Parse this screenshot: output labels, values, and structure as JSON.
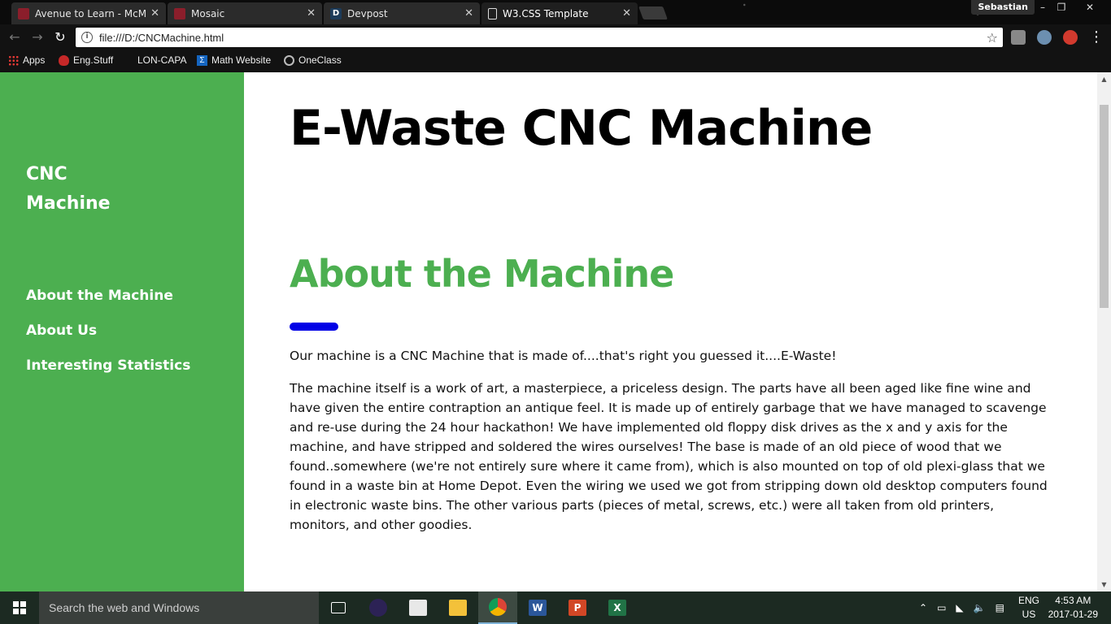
{
  "browser": {
    "tabs": [
      {
        "title": "Avenue to Learn - McMa",
        "active": false
      },
      {
        "title": "Mosaic",
        "active": false
      },
      {
        "title": "Devpost",
        "active": false
      },
      {
        "title": "W3.CSS Template",
        "active": true
      }
    ],
    "tab_close_glyph": "✕",
    "profile_name": "Sebastian",
    "address": "file:///D:/CNCMachine.html",
    "bookmarks": [
      "Apps",
      "Eng.Stuff",
      "LON-CAPA",
      "Math Website",
      "OneClass"
    ],
    "favicon_devpost": "D"
  },
  "page": {
    "brand": [
      "CNC",
      "Machine"
    ],
    "nav": [
      "About the Machine",
      "About Us",
      "Interesting Statistics"
    ],
    "title": "E-Waste CNC Machine",
    "section_title": "About the Machine",
    "paragraph1": "Our machine is a CNC Machine that is made of....that's right you guessed it....E-Waste!",
    "paragraph2": "The machine itself is a work of art, a masterpiece, a priceless design. The parts have all been aged like fine wine and have given the entire contraption an antique feel. It is made up of entirely garbage that we have managed to scavenge and re-use during the 24 hour hackathon! We have implemented old floppy disk drives as the x and y axis for the machine, and have stripped and soldered the wires ourselves! The base is made of an old piece of wood that we found..somewhere (we're not entirely sure where it came from), which is also mounted on top of old plexi-glass that we found in a waste bin at Home Depot. Even the wiring we used we got from stripping down old desktop computers found in electronic waste bins. The other various parts (pieces of metal, screws, etc.) were all taken from old printers, monitors, and other goodies.",
    "colors": {
      "sidebar": "#4caf50",
      "accent_bar": "#0000e6",
      "section_title": "#4caf50"
    }
  },
  "taskbar": {
    "search_placeholder": "Search the web and Windows",
    "lang_top": "ENG",
    "lang_bottom": "US",
    "time": "4:53 AM",
    "date": "2017-01-29",
    "apps": [
      "task-view",
      "eclipse",
      "python",
      "file-explorer",
      "chrome",
      "word",
      "powerpoint",
      "excel"
    ]
  }
}
